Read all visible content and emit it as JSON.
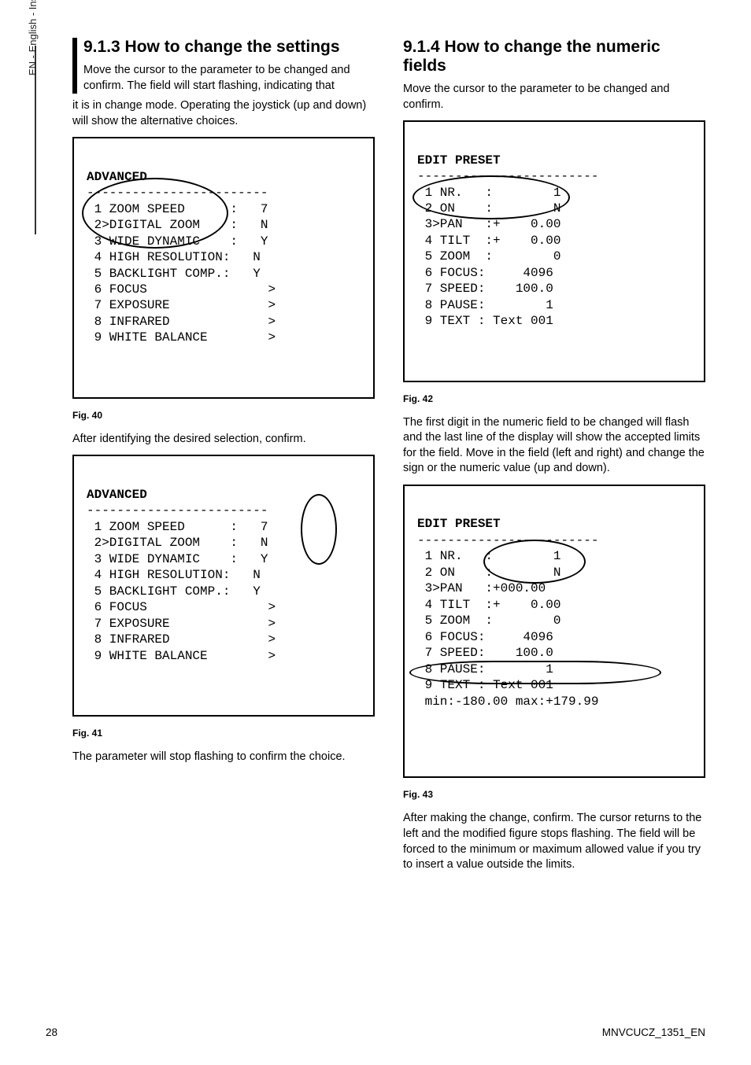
{
  "sidelabel": "EN - English - Instructions manual",
  "left": {
    "h913": "9.1.3 How to change the settings",
    "p913a": "Move the cursor to the parameter to be changed and confirm. The field will start flashing, indicating that it is in change mode. Operating the joystick (up and down) will show the alternative choices.",
    "fig40": "Fig. 40",
    "p_aftersel": "After identifying the desired selection, confirm.",
    "fig41": "Fig. 41",
    "p_stop": "The parameter will stop flashing to confirm the choice.",
    "adv_title": "ADVANCED",
    "adv_rule": "------------------------",
    "adv_lines1": " 1 ZOOM SPEED      :   7\n 2>DIGITAL ZOOM    :   N\n 3 WIDE DYNAMIC    :   Y\n 4 HIGH RESOLUTION:   N\n 5 BACKLIGHT COMP.:   Y\n 6 FOCUS                >\n 7 EXPOSURE             >\n 8 INFRARED             >\n 9 WHITE BALANCE        >",
    "adv_lines2": " 1 ZOOM SPEED      :   7\n 2>DIGITAL ZOOM    :   N\n 3 WIDE DYNAMIC    :   Y\n 4 HIGH RESOLUTION:   N\n 5 BACKLIGHT COMP.:   Y\n 6 FOCUS                >\n 7 EXPOSURE             >\n 8 INFRARED             >\n 9 WHITE BALANCE        >"
  },
  "right": {
    "h914": "9.1.4 How to change the numeric fields",
    "p914a": "Move the cursor to the parameter to be changed and confirm.",
    "fig42": "Fig. 42",
    "p_first": "The first digit in the numeric field to be changed will flash and the last line of the display will show the accepted limits for the field. Move in the field (left and right) and change the sign or the numeric value (up and down).",
    "fig43": "Fig. 43",
    "p_after": "After making the change, confirm. The cursor returns to the left and the modified figure stops flashing. The field will be forced to the minimum or maximum allowed value if you try to insert a value outside the limits.",
    "edit_title": "EDIT PRESET",
    "edit_rule": "------------------------",
    "edit_lines1": " 1 NR.   :        1\n 2 ON    :        N\n 3>PAN   :+    0.00\n 4 TILT  :+    0.00\n 5 ZOOM  :        0\n 6 FOCUS:     4096\n 7 SPEED:    100.0\n 8 PAUSE:        1\n 9 TEXT : Text 001",
    "edit_lines2": " 1 NR.   :        1\n 2 ON    :        N\n 3>PAN   :+000.00\n 4 TILT  :+    0.00\n 5 ZOOM  :        0\n 6 FOCUS:     4096\n 7 SPEED:    100.0\n 8 PAUSE:        1\n 9 TEXT : Text 001\n min:-180.00 max:+179.99"
  },
  "footer": {
    "page": "28",
    "doc": "MNVCUCZ_1351_EN"
  }
}
